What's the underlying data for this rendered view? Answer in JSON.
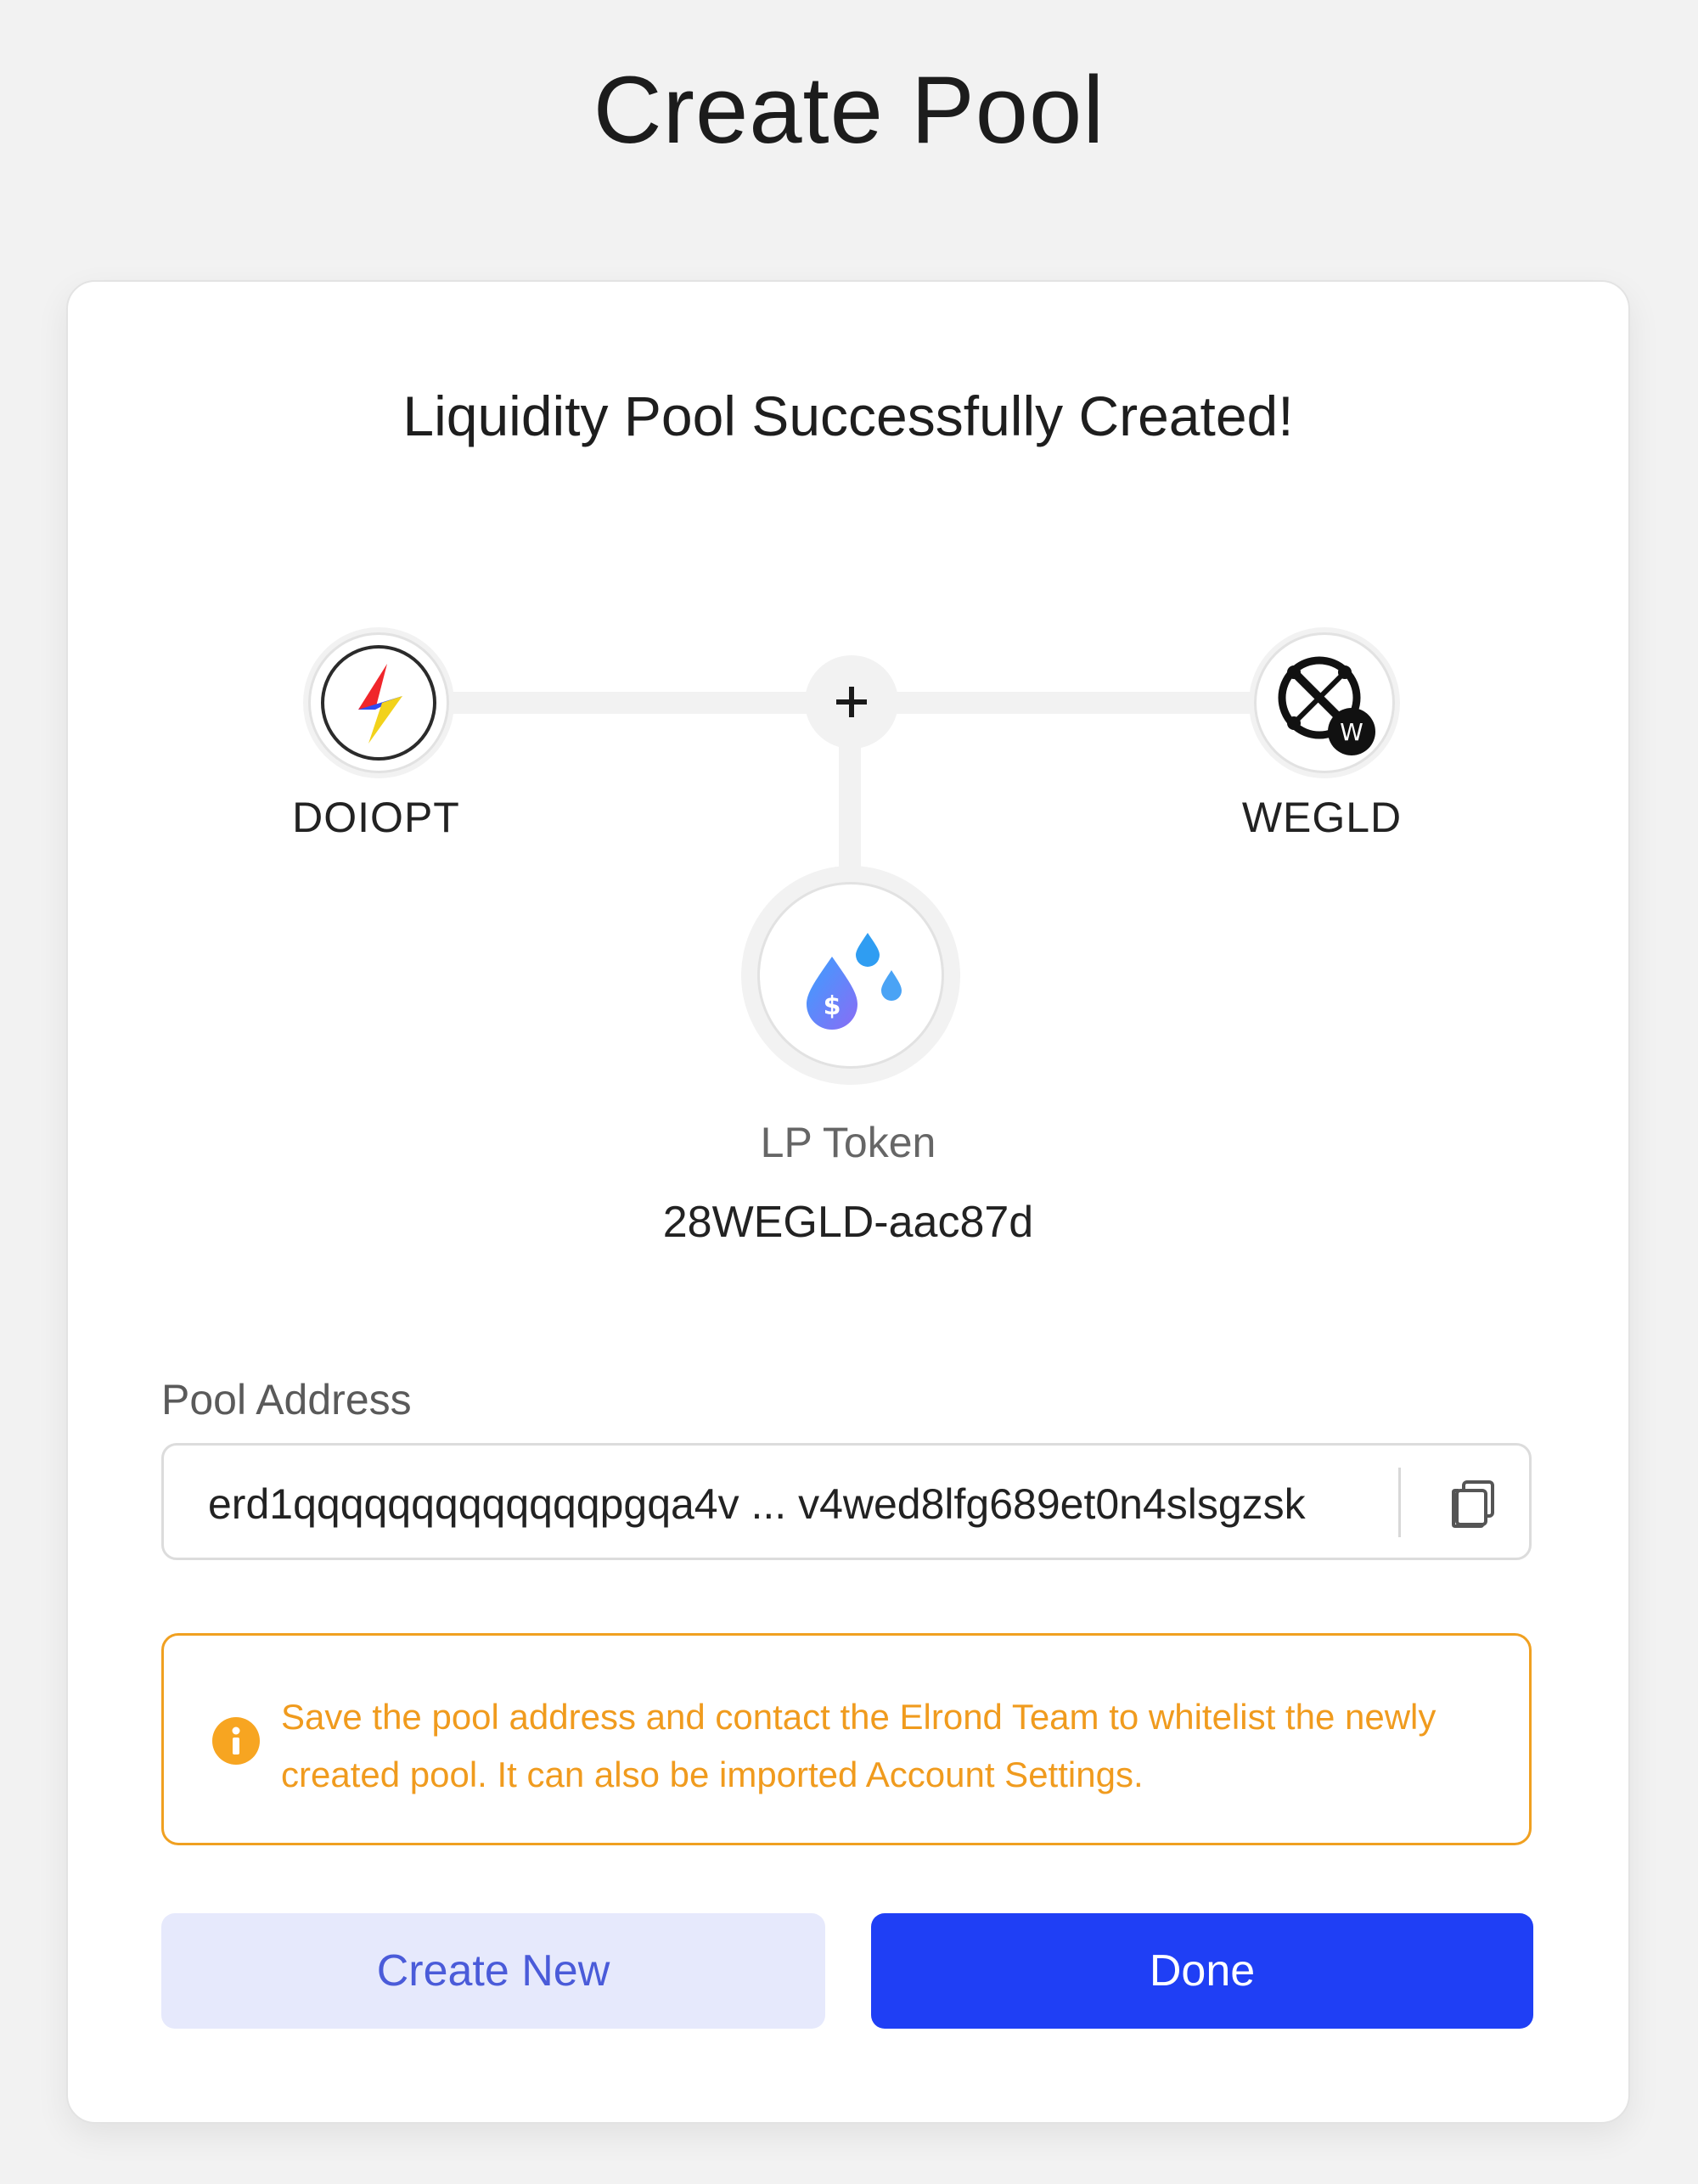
{
  "page": {
    "title": "Create Pool"
  },
  "card": {
    "success_title": "Liquidity Pool Successfully Created!",
    "first_token": {
      "symbol": "DOIOPT",
      "icon": "lightning-bolt-icon"
    },
    "second_token": {
      "symbol": "WEGLD",
      "icon": "egld-logo-icon"
    },
    "plus_icon": "plus-icon",
    "lp_token": {
      "label": "LP Token",
      "id": "28WEGLD-aac87d",
      "icon": "liquidity-drops-icon"
    },
    "pool_address": {
      "label": "Pool Address",
      "value": "erd1qqqqqqqqqqqqqpgqa4v ... v4wed8lfg689et0n4slsgzsk",
      "copy_icon": "copy-icon"
    },
    "warning": {
      "icon": "info-icon",
      "text": "Save the pool address and contact the Elrond Team to whitelist the newly created pool. It can also be imported Account Settings."
    },
    "buttons": {
      "create_new": "Create New",
      "done": "Done"
    }
  },
  "colors": {
    "background": "#f2f2f2",
    "card": "#ffffff",
    "primary": "#1f3ff5",
    "secondary_bg": "#e6e9fc",
    "secondary_text": "#4a5bd9",
    "warning": "#f09b1e"
  }
}
